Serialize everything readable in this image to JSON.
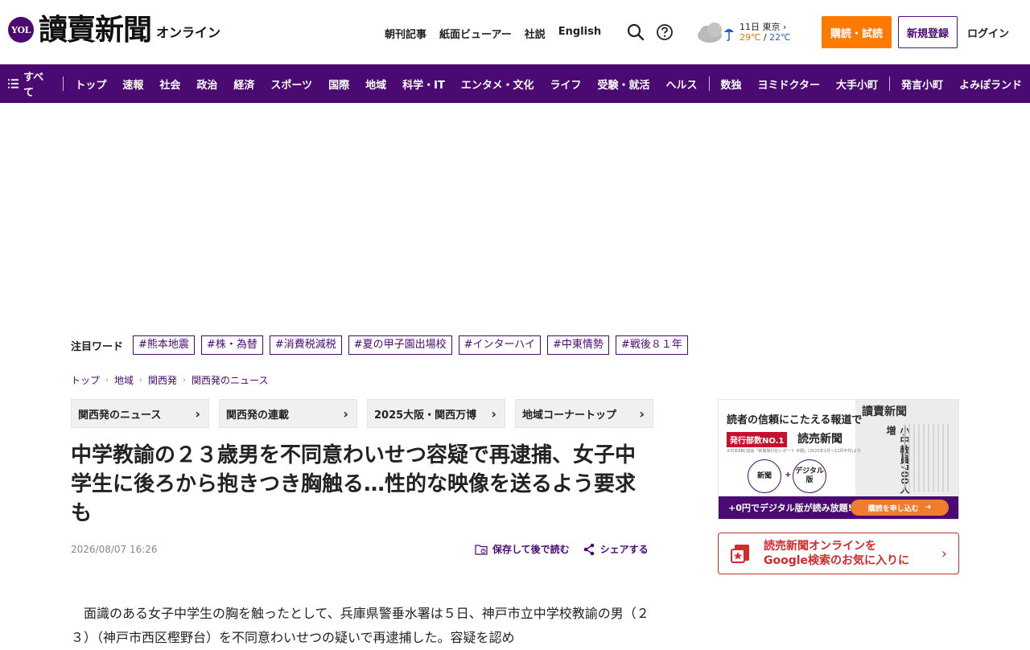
{
  "header": {
    "logo_badge": "YOL",
    "logo_title": "讀賣新聞",
    "logo_sub": "オンライン",
    "top_links": [
      "朝刊記事",
      "紙面ビューアー",
      "社説",
      "English"
    ],
    "weather": {
      "date_place": "11日 東京",
      "temp_high": "29℃",
      "temp_sep": "/",
      "temp_low": "22℃"
    },
    "subscribe_label": "購読・試読",
    "register_label": "新規登録",
    "login_label": "ログイン"
  },
  "nav": {
    "all_label": "すべて",
    "items": [
      "トップ",
      "速報",
      "社会",
      "政治",
      "経済",
      "スポーツ",
      "国際",
      "地域",
      "科学・IT",
      "エンタメ・文化",
      "ライフ",
      "受験・就活",
      "ヘルス"
    ],
    "items2": [
      "数独",
      "ヨミドクター",
      "大手小町"
    ],
    "items3": [
      "発言小町",
      "よみぽランド"
    ]
  },
  "trending": {
    "label": "注目ワード",
    "tags": [
      "#熊本地震",
      "#株・為替",
      "#消費税減税",
      "#夏の甲子園出場校",
      "#インターハイ",
      "#中東情勢",
      "#戦後８１年"
    ]
  },
  "breadcrumb": [
    "トップ",
    "地域",
    "関西発",
    "関西発のニュース"
  ],
  "subnav": [
    "関西発のニュース",
    "関西発の連載",
    "2025大阪・関西万博",
    "地域コーナートップ"
  ],
  "article": {
    "headline": "中学教諭の２３歳男を不同意わいせつ容疑で再逮捕、女子中学生に後ろから抱きつき胸触る…性的な映像を送るよう要求も",
    "date": "2026/08/07 16:26",
    "save_label": "保存して後で読む",
    "share_label": "シェアする",
    "body": "面識のある女子中学生の胸を触ったとして、兵庫県警垂水署は５日、神戸市立中学校教諭の男（２３）（神戸市西区樫野台）を不同意わいせつの疑いで再逮捕した。容疑を認め"
  },
  "sidebar": {
    "ad": {
      "line1": "読者の信頼にこたえる報道で",
      "badge": "発行部数NO.1",
      "brand": "読売新聞",
      "small": "※日本ABC協会「新聞発行社レポート 半期」(2025年1月〜12月平均)より",
      "circle1": "新聞",
      "plus": "+",
      "circle2": "デジタル版",
      "paper_title": "讀賣新聞",
      "paper_head": "小中教員700人増",
      "bar_text": "+0円でデジタル版が読み放題!",
      "cta": "購読を申し込む"
    },
    "google_fav": {
      "line1": "読売新聞オンラインを",
      "line2": "Google検索のお気に入りに"
    }
  },
  "colors": {
    "brand_purple": "#4a0a72",
    "subscribe_orange": "#ff7a00",
    "accent_red": "#d42a2a"
  }
}
